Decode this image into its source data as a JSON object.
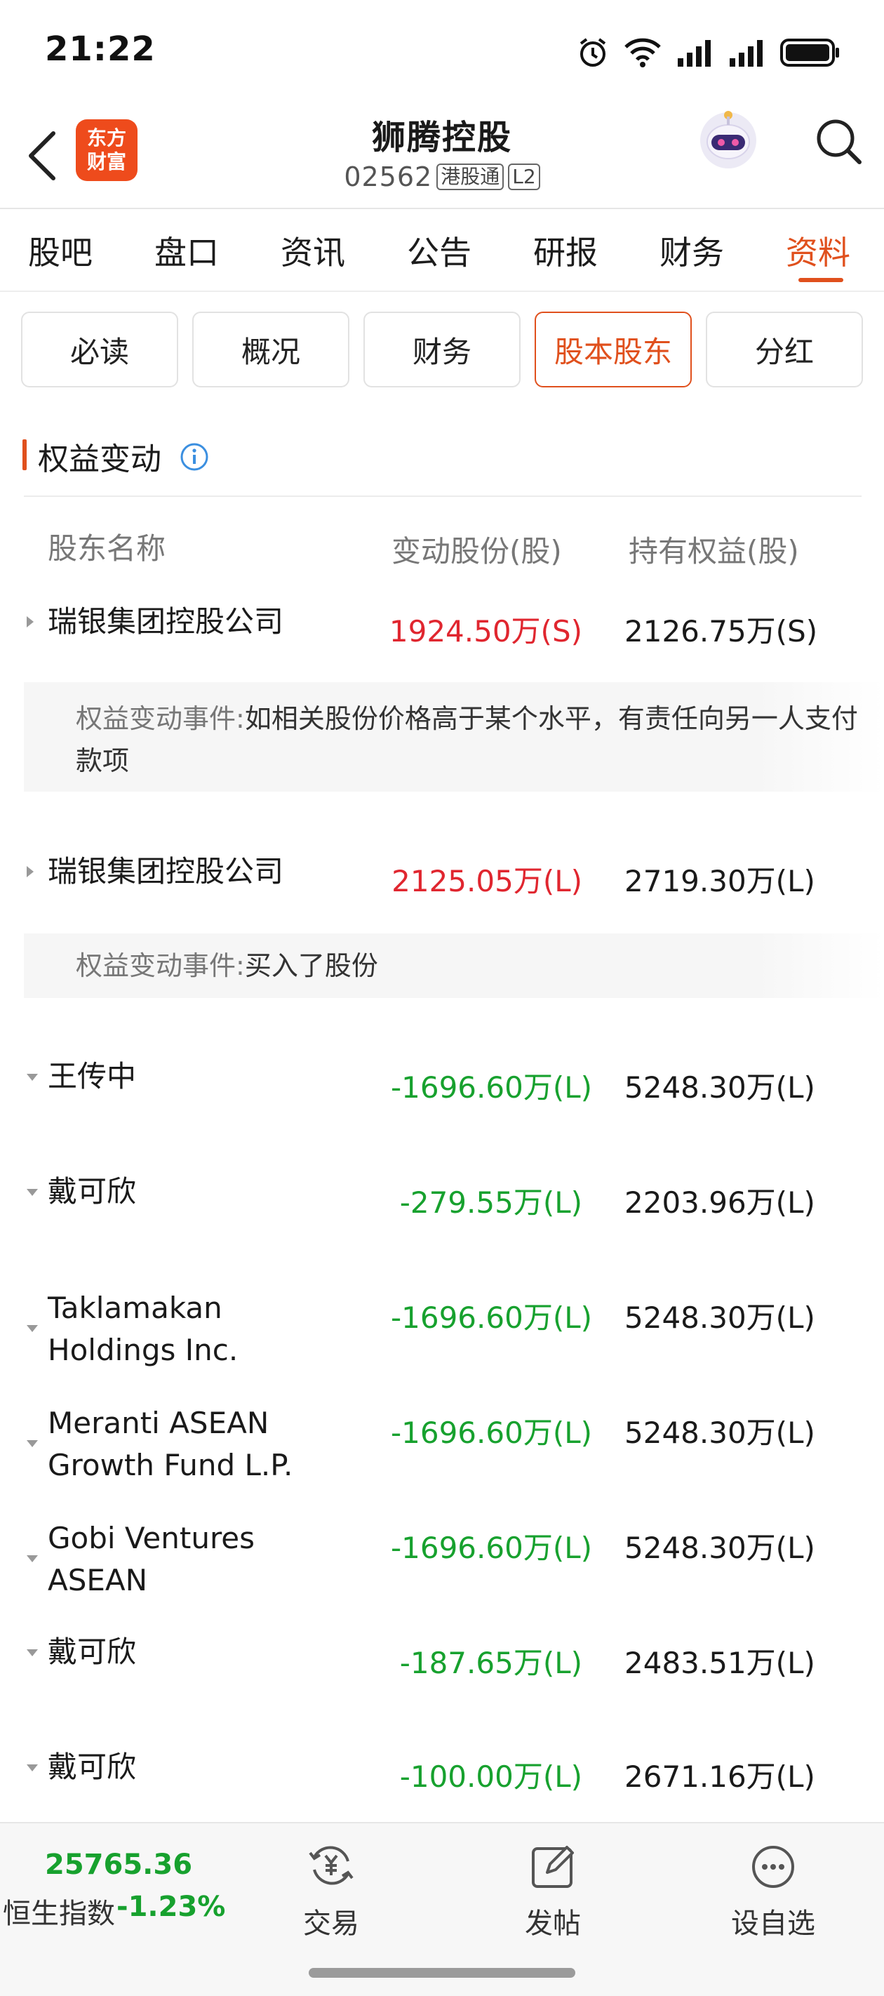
{
  "status_bar": {
    "time": "21:22"
  },
  "header": {
    "logo_line1": "东方",
    "logo_line2": "财富",
    "stock_name": "狮腾控股",
    "stock_code": "02562",
    "tag_hk": "港股通",
    "tag_level": "L2"
  },
  "main_tabs": [
    {
      "label": "股吧"
    },
    {
      "label": "盘口"
    },
    {
      "label": "资讯"
    },
    {
      "label": "公告"
    },
    {
      "label": "研报"
    },
    {
      "label": "财务"
    },
    {
      "label": "资料"
    }
  ],
  "main_tabs_active": "资料",
  "sub_tabs": [
    {
      "label": "必读"
    },
    {
      "label": "概况"
    },
    {
      "label": "财务"
    },
    {
      "label": "股本股东"
    },
    {
      "label": "分红"
    }
  ],
  "sub_tabs_active": "股本股东",
  "section": {
    "title": "权益变动"
  },
  "table": {
    "headers": {
      "name": "股东名称",
      "change": "变动股份(股)",
      "hold": "持有权益(股)"
    },
    "event_label": "权益变动事件:",
    "rows": [
      {
        "name": "瑞银集团控股公司",
        "change": "1924.50万(S)",
        "hold": "2126.75万(S)",
        "direction": "up",
        "expanded": true,
        "event": "如相关股份价格高于某个水平，有责任向另一人支付款项"
      },
      {
        "name": "瑞银集团控股公司",
        "change": "2125.05万(L)",
        "hold": "2719.30万(L)",
        "direction": "up",
        "expanded": true,
        "event": "买入了股份"
      },
      {
        "name": "王传中",
        "change": "-1696.60万(L)",
        "hold": "5248.30万(L)",
        "direction": "down",
        "expanded": false
      },
      {
        "name": "戴可欣",
        "change": "-279.55万(L)",
        "hold": "2203.96万(L)",
        "direction": "down",
        "expanded": false
      },
      {
        "name_line1": "Taklamakan",
        "name_line2": "Holdings Inc.",
        "change": "-1696.60万(L)",
        "hold": "5248.30万(L)",
        "direction": "down",
        "expanded": false
      },
      {
        "name_line1": "Meranti ASEAN",
        "name_line2": "Growth Fund L.P.",
        "change": "-1696.60万(L)",
        "hold": "5248.30万(L)",
        "direction": "down",
        "expanded": false
      },
      {
        "name_line1": "Gobi Ventures",
        "name_line2": "ASEAN",
        "change": "-1696.60万(L)",
        "hold": "5248.30万(L)",
        "direction": "down",
        "expanded": false
      },
      {
        "name": "戴可欣",
        "change": "-187.65万(L)",
        "hold": "2483.51万(L)",
        "direction": "down",
        "expanded": false
      },
      {
        "name": "戴可欣",
        "change": "-100.00万(L)",
        "hold": "2671.16万(L)",
        "direction": "down",
        "expanded": false
      }
    ]
  },
  "bottom_bar": {
    "index_value": "25765.36",
    "index_name": "恒生指数",
    "index_change": "-1.23%",
    "trade_label": "交易",
    "post_label": "发帖",
    "watchlist_label": "设自选"
  },
  "colors": {
    "accent": "#e0501d",
    "up": "#e0262f",
    "down": "#17a12e",
    "logo_bg": "#ee4b1c"
  },
  "icons": [
    "alarm-icon",
    "wifi-icon",
    "signal-icon",
    "battery-icon",
    "back-arrow-icon",
    "robot-avatar-icon",
    "search-icon",
    "info-icon",
    "yuan-exchange-icon",
    "edit-icon",
    "more-icon"
  ]
}
